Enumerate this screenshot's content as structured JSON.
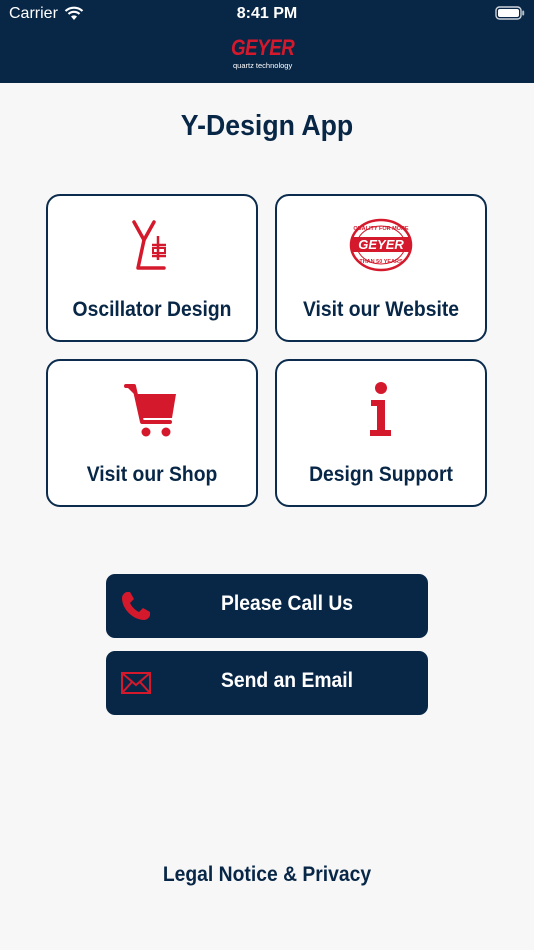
{
  "status_bar": {
    "carrier": "Carrier",
    "time": "8:41 PM"
  },
  "brand": {
    "name": "GEYER",
    "tagline": "quartz technology"
  },
  "app": {
    "title": "Y-Design App"
  },
  "tiles": [
    {
      "label": "Oscillator Design",
      "icon": "oscillator-symbol-icon"
    },
    {
      "label": "Visit our Website",
      "icon": "quality-stamp-icon",
      "stamp_top": "QUALITY FOR MORE",
      "stamp_center": "GEYER",
      "stamp_bottom": "THAN 50 YEARS"
    },
    {
      "label": "Visit our Shop",
      "icon": "shopping-cart-icon"
    },
    {
      "label": "Design Support",
      "icon": "info-icon"
    }
  ],
  "actions": {
    "call_label": "Please Call Us",
    "email_label": "Send an Email"
  },
  "footer": {
    "legal_label": "Legal Notice & Privacy"
  },
  "colors": {
    "navy": "#082747",
    "accent_red": "#d5192c",
    "background": "#f7f7f7"
  }
}
